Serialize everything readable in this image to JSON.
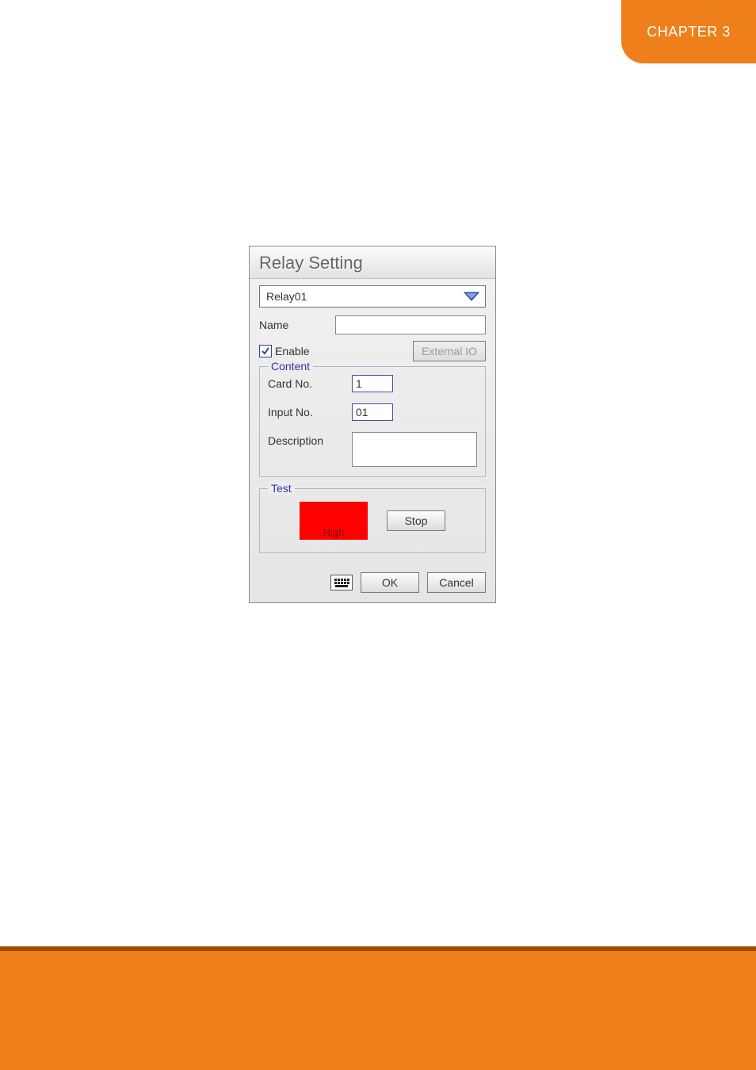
{
  "chapter": {
    "label": "CHAPTER 3"
  },
  "dialog": {
    "title": "Relay Setting",
    "relay_select": "Relay01",
    "name_label": "Name",
    "name_value": "",
    "enable_label": "Enable",
    "enable_checked": true,
    "external_io_label": "External IO",
    "content": {
      "legend": "Content",
      "card_no_label": "Card No.",
      "card_no_value": "1",
      "input_no_label": "Input No.",
      "input_no_value": "01",
      "description_label": "Description",
      "description_value": ""
    },
    "test": {
      "legend": "Test",
      "status": "High",
      "stop_label": "Stop"
    },
    "ok_label": "OK",
    "cancel_label": "Cancel"
  }
}
